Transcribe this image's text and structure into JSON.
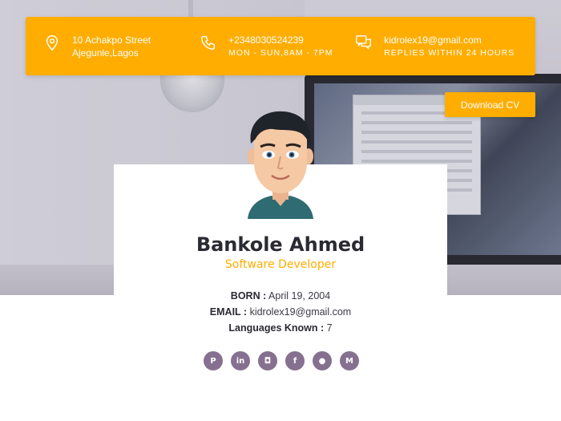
{
  "contact": {
    "address_line1": "10 Achakpo Street",
    "address_line2": "Ajegunle,Lagos",
    "phone": "+2348030524239",
    "hours": "MON - SUN,8AM - 7PM",
    "email": "kidrolex19@gmail.com",
    "reply_note": "REPLIES WITHIN 24 HOURS",
    "icons": [
      "location-pin-icon",
      "phone-icon",
      "chat-icon"
    ]
  },
  "download_label": "Download CV",
  "profile": {
    "name": "Bankole Ahmed",
    "role": "Software Developer",
    "born_label": "BORN :",
    "born_value": "April 19, 2004",
    "email_label": "EMAIL :",
    "email_value": "kidrolex19@gmail.com",
    "languages_label": "Languages Known :",
    "languages_value": "7"
  },
  "socials": [
    {
      "name": "pinterest-icon",
      "glyph": "P"
    },
    {
      "name": "linkedin-icon",
      "glyph": "in"
    },
    {
      "name": "instagram-icon",
      "glyph": "◘"
    },
    {
      "name": "facebook-icon",
      "glyph": "f"
    },
    {
      "name": "github-icon",
      "glyph": "●"
    },
    {
      "name": "medium-icon",
      "glyph": "M"
    }
  ],
  "colors": {
    "accent": "#ffad00",
    "social_bg": "#86708f",
    "heading": "#2a2a32"
  }
}
